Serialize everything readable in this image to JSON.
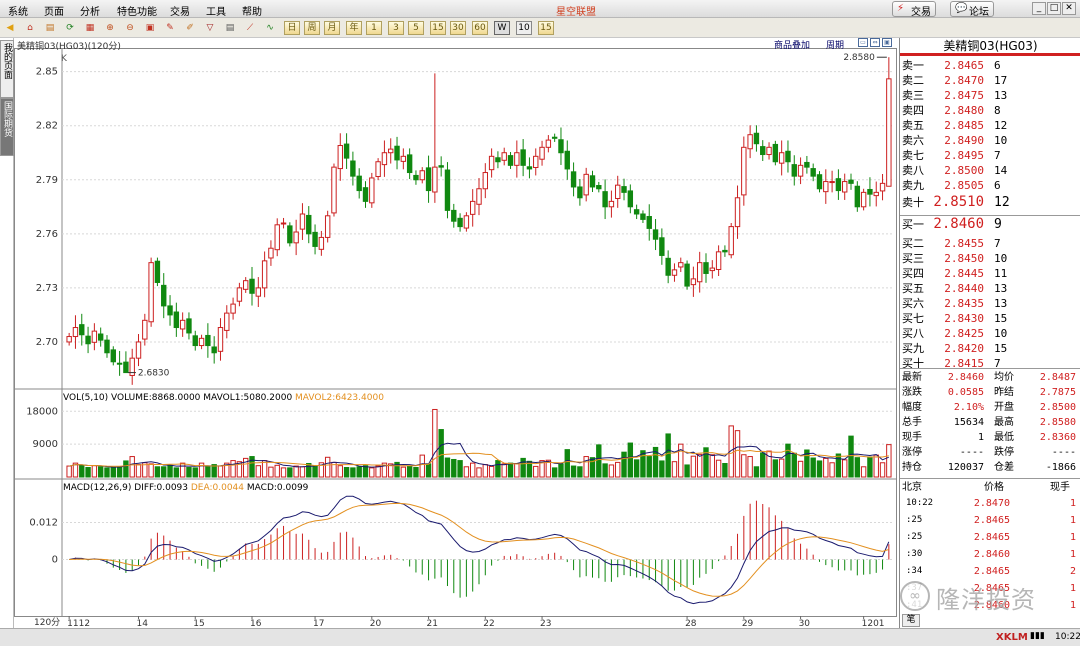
{
  "menubar": {
    "items": [
      "系统",
      "页面",
      "分析",
      "特色功能",
      "交易",
      "工具",
      "帮助"
    ],
    "app_title": "星空联盟",
    "trade_button": "交易",
    "forum_button": "论坛"
  },
  "toolbar": {
    "period_buttons": [
      "日",
      "周",
      "月",
      "年",
      "1",
      "3",
      "5",
      "15",
      "30",
      "60",
      "W",
      "10",
      "15"
    ]
  },
  "sidetabs": [
    "我的页面",
    "国际期货"
  ],
  "chart_header": {
    "title": "美精铜03(HG03)(120分)",
    "link_overlay": "商品叠加",
    "link_period": "周期",
    "k_label": "K",
    "high_annot": "2.8580",
    "low_annot": "2.6830",
    "vol_header_prefix": "VOL(5,10) VOLUME:8868.0000",
    "vol_mavol1": "MAVOL1:5080.2000",
    "vol_mavol2": "MAVOL2:6423.4000",
    "macd_header_prefix": "MACD(12,26,9)",
    "macd_diff": "DIFF:0.0093",
    "macd_dea": "DEA:0.0044",
    "macd_val": "MACD:0.0099",
    "period_label": "120分"
  },
  "chart_data": {
    "type": "candlestick",
    "price_yticks": [
      "2.85",
      "2.82",
      "2.79",
      "2.76",
      "2.73",
      "2.70"
    ],
    "price_ylim": [
      2.675,
      2.862
    ],
    "volume_yticks": [
      "18000",
      "9000"
    ],
    "volume_ylim": [
      0,
      20000
    ],
    "macd_yticks": [
      "0.012",
      "0"
    ],
    "x_labels": [
      "1112",
      "14",
      "15",
      "16",
      "17",
      "20",
      "21",
      "22",
      "23",
      "28",
      "29",
      "30",
      "1201"
    ],
    "x_label_bar_index": [
      0,
      11,
      20,
      29,
      39,
      48,
      57,
      66,
      75,
      98,
      107,
      116,
      126
    ],
    "closes": [
      2.703,
      2.708,
      2.704,
      2.699,
      2.706,
      2.701,
      2.694,
      2.689,
      2.688,
      2.683,
      2.691,
      2.7,
      2.712,
      2.744,
      2.733,
      2.72,
      2.715,
      2.708,
      2.712,
      2.705,
      2.698,
      2.702,
      2.698,
      2.694,
      2.708,
      2.716,
      2.721,
      2.73,
      2.734,
      2.727,
      2.73,
      2.745,
      2.752,
      2.765,
      2.766,
      2.755,
      2.761,
      2.771,
      2.76,
      2.753,
      2.758,
      2.77,
      2.797,
      2.809,
      2.802,
      2.792,
      2.784,
      2.778,
      2.791,
      2.8,
      2.805,
      2.807,
      2.801,
      2.803,
      2.794,
      2.79,
      2.795,
      2.784,
      2.797,
      2.797,
      2.773,
      2.767,
      2.764,
      2.77,
      2.778,
      2.785,
      2.794,
      2.803,
      2.8,
      2.805,
      2.798,
      2.805,
      2.798,
      2.796,
      2.803,
      2.808,
      2.812,
      2.813,
      2.805,
      2.796,
      2.786,
      2.78,
      2.793,
      2.786,
      2.785,
      2.775,
      2.778,
      2.787,
      2.783,
      2.775,
      2.771,
      2.768,
      2.763,
      2.757,
      2.748,
      2.737,
      2.74,
      2.744,
      2.731,
      2.735,
      2.744,
      2.738,
      2.741,
      2.75,
      2.75,
      2.764,
      2.78,
      2.808,
      2.815,
      2.81,
      2.804,
      2.808,
      2.8,
      2.805,
      2.8,
      2.792,
      2.798,
      2.797,
      2.792,
      2.785,
      2.789,
      2.789,
      2.784,
      2.789,
      2.788,
      2.775,
      2.783,
      2.782,
      2.783,
      2.788,
      2.846
    ],
    "volumes": [
      3000,
      3800,
      3200,
      2600,
      3100,
      2800,
      2500,
      2600,
      2700,
      4400,
      5600,
      3400,
      3900,
      3600,
      2800,
      2800,
      3200,
      2500,
      3800,
      2600,
      2500,
      3800,
      2800,
      3400,
      3000,
      3800,
      4500,
      4200,
      5100,
      5600,
      3100,
      4500,
      2700,
      3200,
      2500,
      2500,
      3000,
      2800,
      3700,
      3100,
      3900,
      5400,
      4000,
      3100,
      2600,
      2500,
      2800,
      3100,
      2500,
      3000,
      3800,
      3600,
      4000,
      2700,
      2900,
      2600,
      6000,
      3600,
      18500,
      13000,
      5200,
      4800,
      4500,
      2800,
      3800,
      2500,
      3400,
      2900,
      4500,
      3600,
      3800,
      3700,
      5100,
      4300,
      2900,
      4500,
      4600,
      2500,
      3600,
      7500,
      3000,
      2800,
      5600,
      5300,
      8800,
      3600,
      3300,
      4000,
      6800,
      9300,
      4700,
      7200,
      5600,
      8100,
      4400,
      11800,
      4200,
      9000,
      3300,
      5700,
      6200,
      8000,
      6100,
      4600,
      3700,
      14000,
      12700,
      6100,
      5600,
      2800,
      6600,
      7100,
      4700,
      4900,
      9000,
      6500,
      4300,
      7400,
      5200,
      4400,
      5100,
      3900,
      6300,
      4700,
      11200,
      5300,
      2800,
      5500,
      6000,
      3900,
      8868
    ],
    "ma_volume_5": 5080.2,
    "ma_volume_10": 6423.4,
    "macd_diff": 0.0093,
    "macd_dea": 0.0044,
    "macd_hist": 0.0099
  },
  "right_panel": {
    "title": "美精铜03(HG03)",
    "asks": [
      {
        "label": "卖十",
        "price": "2.8510",
        "qty": "12"
      },
      {
        "label": "卖九",
        "price": "2.8505",
        "qty": "6"
      },
      {
        "label": "卖八",
        "price": "2.8500",
        "qty": "14"
      },
      {
        "label": "卖七",
        "price": "2.8495",
        "qty": "7"
      },
      {
        "label": "卖六",
        "price": "2.8490",
        "qty": "10"
      },
      {
        "label": "卖五",
        "price": "2.8485",
        "qty": "12"
      },
      {
        "label": "卖四",
        "price": "2.8480",
        "qty": "8"
      },
      {
        "label": "卖三",
        "price": "2.8475",
        "qty": "13"
      },
      {
        "label": "卖二",
        "price": "2.8470",
        "qty": "17"
      },
      {
        "label": "卖一",
        "price": "2.8465",
        "qty": "6"
      }
    ],
    "bids": [
      {
        "label": "买一",
        "price": "2.8460",
        "qty": "9"
      },
      {
        "label": "买二",
        "price": "2.8455",
        "qty": "7"
      },
      {
        "label": "买三",
        "price": "2.8450",
        "qty": "10"
      },
      {
        "label": "买四",
        "price": "2.8445",
        "qty": "11"
      },
      {
        "label": "买五",
        "price": "2.8440",
        "qty": "13"
      },
      {
        "label": "买六",
        "price": "2.8435",
        "qty": "13"
      },
      {
        "label": "买七",
        "price": "2.8430",
        "qty": "15"
      },
      {
        "label": "买八",
        "price": "2.8425",
        "qty": "10"
      },
      {
        "label": "买九",
        "price": "2.8420",
        "qty": "15"
      },
      {
        "label": "买十",
        "price": "2.8415",
        "qty": "7"
      }
    ],
    "stats": [
      {
        "l1": "最新",
        "v1": "2.8460",
        "l2": "均价",
        "v2": "2.8487"
      },
      {
        "l1": "涨跌",
        "v1": "0.0585",
        "l2": "昨结",
        "v2": "2.7875"
      },
      {
        "l1": "幅度",
        "v1": "2.10%",
        "l2": "开盘",
        "v2": "2.8500"
      },
      {
        "l1": "总手",
        "v1": "15634",
        "l2": "最高",
        "v2": "2.8580"
      },
      {
        "l1": "现手",
        "v1": "1",
        "l2": "最低",
        "v2": "2.8360"
      },
      {
        "l1": "涨停",
        "v1": "----",
        "l2": "跌停",
        "v2": "----"
      },
      {
        "l1": "持仓",
        "v1": "120037",
        "l2": "仓差",
        "v2": "-1866"
      }
    ],
    "tick_header": {
      "col1": "北京",
      "col2": "价格",
      "col3": "现手"
    },
    "ticks": [
      {
        "time": "10:22",
        "price": "2.8470",
        "qty": "1"
      },
      {
        "time": ":25",
        "price": "2.8465",
        "qty": "1"
      },
      {
        "time": ":25",
        "price": "2.8465",
        "qty": "1"
      },
      {
        "time": ":30",
        "price": "2.8460",
        "qty": "1"
      },
      {
        "time": ":34",
        "price": "2.8465",
        "qty": "2"
      },
      {
        "time": ":37",
        "price": "2.8465",
        "qty": "1"
      },
      {
        "time": ":41",
        "price": "2.8460",
        "qty": "1"
      }
    ],
    "bottom_tab": "笔"
  },
  "statusbar": {
    "brand": "XKLM",
    "clock": "10:22"
  },
  "watermark": {
    "text": "隆洋投资"
  },
  "colors": {
    "up": "#cc2020",
    "down": "#108810",
    "dif_line": "#1a1a6e",
    "dea_line": "#e39020"
  }
}
